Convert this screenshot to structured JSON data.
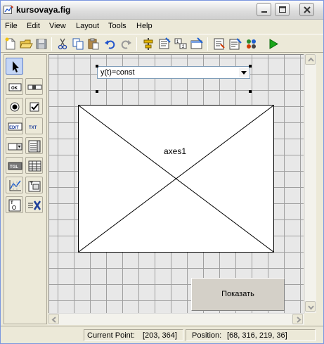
{
  "window": {
    "title": "kursovaya.fig"
  },
  "menu": [
    "File",
    "Edit",
    "View",
    "Layout",
    "Tools",
    "Help"
  ],
  "toolbar": [
    "new-figure-icon",
    "open-file-icon",
    "save-icon",
    "cut-icon",
    "copy-icon",
    "paste-icon",
    "undo-icon",
    "redo-icon",
    "align-objects-icon",
    "menu-editor-icon",
    "tab-order-editor-icon",
    "toolbar-editor-icon",
    "editor-icon",
    "property-inspector-icon",
    "object-browser-icon",
    "run-figure-icon"
  ],
  "palette": [
    {
      "name": "select-tool",
      "label": ""
    },
    {
      "name": "push-button-tool",
      "label": "OK"
    },
    {
      "name": "slider-tool",
      "label": ""
    },
    {
      "name": "radio-button-tool",
      "label": ""
    },
    {
      "name": "checkbox-tool",
      "label": ""
    },
    {
      "name": "edit-text-tool",
      "label": "EDIT"
    },
    {
      "name": "static-text-tool",
      "label": "TXT"
    },
    {
      "name": "popup-menu-tool",
      "label": ""
    },
    {
      "name": "listbox-tool",
      "label": ""
    },
    {
      "name": "toggle-button-tool",
      "label": "TGL"
    },
    {
      "name": "table-tool",
      "label": ""
    },
    {
      "name": "axes-tool",
      "label": ""
    },
    {
      "name": "panel-tool",
      "label": ""
    },
    {
      "name": "button-group-tool",
      "label": ""
    },
    {
      "name": "activex-tool",
      "label": ""
    }
  ],
  "canvas": {
    "popup": {
      "value": "y(t)=const"
    },
    "axes": {
      "label": "axes1"
    },
    "button": {
      "label": "Показать"
    }
  },
  "status": {
    "current_point_label": "Current Point:",
    "current_point_value": "[203, 364]",
    "position_label": "Position:",
    "position_value": "[68, 316, 219, 36]"
  },
  "colors": {
    "run_green": "#1aa61a",
    "grid": "#9f9f9f",
    "canvas_bg": "#e8e8e8",
    "selected_tool": "#c5d6f5"
  }
}
